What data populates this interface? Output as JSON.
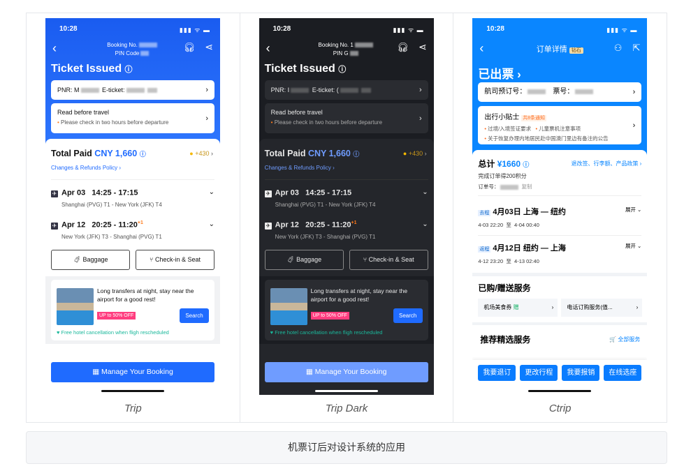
{
  "colors": {
    "trip_blue": "#1f6bff",
    "ctrip_blue": "#0a86ff",
    "dark_bg": "#1b1d22",
    "orange": "#ff7a1a"
  },
  "trip": {
    "time": "10:28",
    "booking_label": "Booking No.",
    "pin_label": "PIN Code",
    "title": "Ticket Issued",
    "pnr_label": "PNR: M",
    "eticket_label": "E-ticket:",
    "read_title": "Read before travel",
    "read_note": "Please check in two hours before departure",
    "total_label": "Total Paid",
    "total_amount": "CNY 1,660",
    "points": "+430",
    "policy": "Changes & Refunds Policy",
    "flights": [
      {
        "date": "Apr 03",
        "time": "14:25 - 17:15",
        "plus": "",
        "route": "Shanghai (PVG) T1 - New York (JFK) T4"
      },
      {
        "date": "Apr 12",
        "time": "20:25 - 11:20",
        "plus": "+1",
        "route": "New York (JFK) T3 - Shanghai (PVG) T1"
      }
    ],
    "baggage": "Baggage",
    "checkin": "Check-in & Seat",
    "promo_text": "Long transfers at night, stay near the airport for a good rest!",
    "promo_badge": "UP to 50% OFF",
    "promo_search": "Search",
    "promo_note": "Free hotel cancellation when fligh rescheduled",
    "manage": "Manage Your Booking",
    "caption": "Trip"
  },
  "dark": {
    "time": "10:28",
    "booking_label": "Booking No. 1",
    "pin_label": "PIN G",
    "title": "Ticket Issued",
    "pnr_label": "PNR: I",
    "eticket_label": "E-ticket: (",
    "read_title": "Read before travel",
    "read_note": "Please check in two hours before departure",
    "total_label": "Total Paid",
    "total_amount": "CNY 1,660",
    "points": "+430",
    "policy": "Changes & Refunds Policy",
    "flights": [
      {
        "date": "Apr 03",
        "time": "14:25 - 17:15",
        "plus": "",
        "route": "Shanghai (PVG) T1 - New York (JFK) T4"
      },
      {
        "date": "Apr 12",
        "time": "20:25 - 11:20",
        "plus": "+1",
        "route": "New York (JFK) T3 - Shanghai (PVG) T1"
      }
    ],
    "baggage": "Baggage",
    "checkin": "Check-in & Seat",
    "promo_text": "Long transfers at night, stay near the airport for a good rest!",
    "promo_badge": "UP to 50% OFF",
    "promo_search": "Search",
    "promo_note": "Free hotel cancellation when fligh rescheduled",
    "manage": "Manage Your Booking",
    "caption": "Trip Dark"
  },
  "ctrip": {
    "time": "10:28",
    "nav_title": "订单详情",
    "vip_badge": "钻石",
    "title": "已出票",
    "pnr_label": "航司预订号：",
    "ticket_label": "票号：",
    "tips_title": "出行小贴士",
    "tips_badge": "共8条通知",
    "tips": [
      "过境/入境签证要求",
      "儿童票机注意事项",
      "关于恢复办理内地居民赴中国澳门里边有备注的公告"
    ],
    "total_label": "总计",
    "total_amount": "¥1660",
    "policy": "退改签、行李额、产品政策",
    "points_note": "完成订单得200积分",
    "order_label": "订单号：",
    "copy": "复制",
    "flights": [
      {
        "tag": "去程",
        "title": "4月03日  上海 — 纽约",
        "times": "4-03 22:20  至  4-04 00:40",
        "expand": "展开"
      },
      {
        "tag": "返程",
        "title": "4月12日  纽约 — 上海",
        "times": "4-12 23:20  至  4-13 02:40",
        "expand": "展开"
      }
    ],
    "services_title": "已购/赠送服务",
    "services": [
      {
        "name": "机场美食券",
        "tag": "赠"
      },
      {
        "name": "电话订购服务(值...",
        "tag": ""
      }
    ],
    "recommend_title": "推荐精选服务",
    "all_services": "全部服务",
    "buttons": [
      "我要退订",
      "更改行程",
      "我要报销",
      "在线选座"
    ],
    "caption": "Ctrip"
  },
  "footer": "机票订后对设计系统的应用"
}
